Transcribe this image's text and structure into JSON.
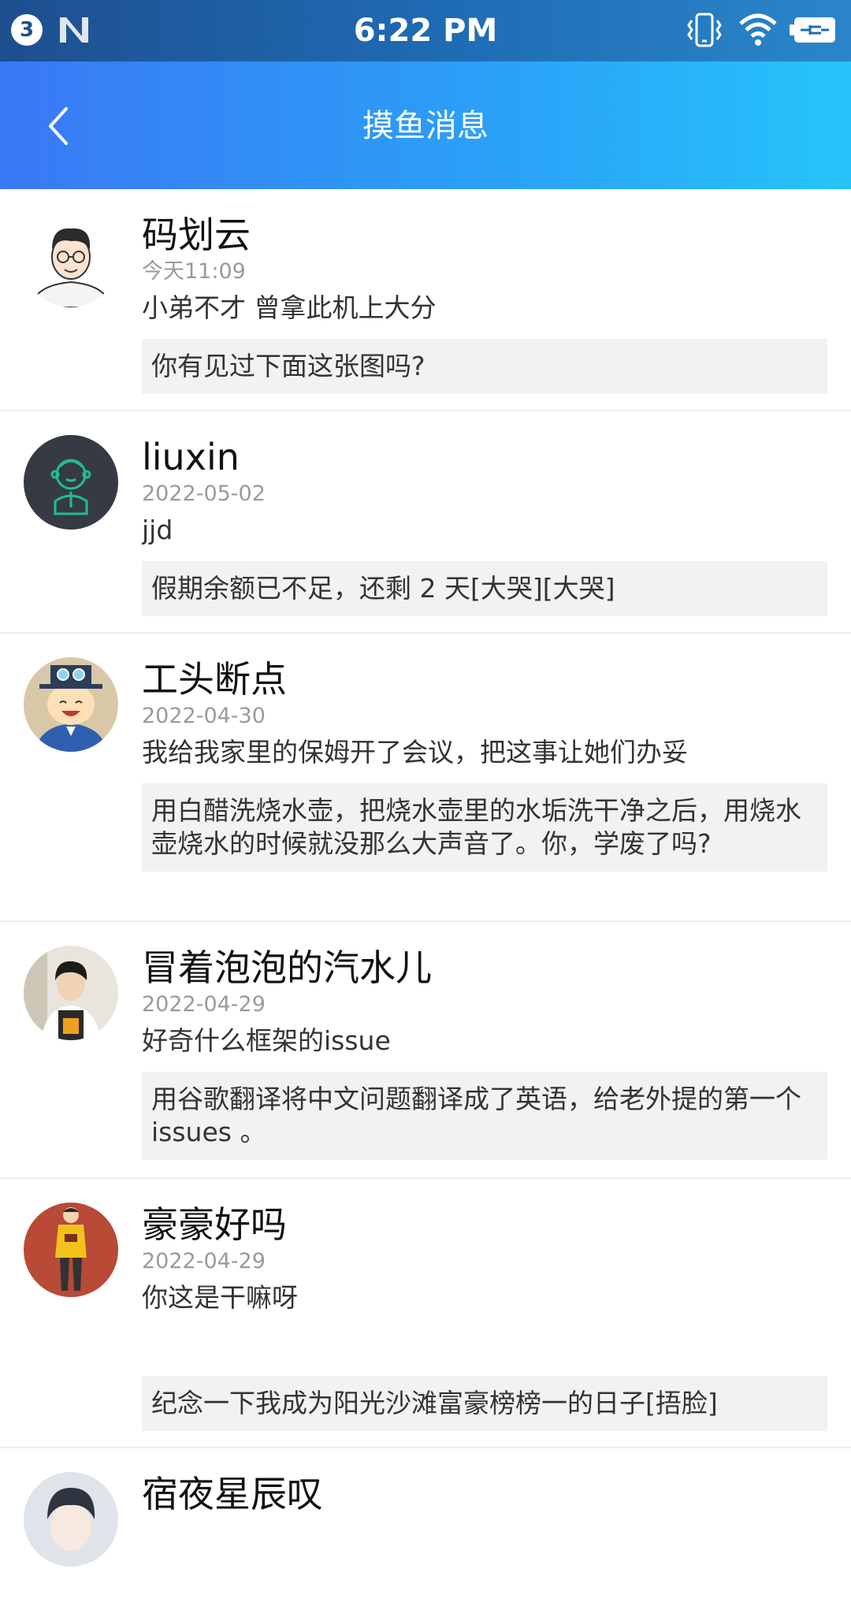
{
  "status_bar": {
    "notification_count": "3",
    "time": "6:22 PM",
    "icons": [
      "notification-badge-icon",
      "n-app-icon",
      "vibrate-icon",
      "wifi-icon",
      "battery-charging-icon"
    ]
  },
  "header": {
    "title": "摸鱼消息",
    "back_icon": "chevron-left-icon"
  },
  "messages": [
    {
      "name": "码划云",
      "date": "今天11:09",
      "text": "小弟不才 曾拿此机上大分",
      "quote": "你有见过下面这张图吗?",
      "avatar": "cartoon-glasses-man"
    },
    {
      "name": "liuxin",
      "date": "2022-05-02",
      "text": "jjd",
      "quote": "假期余额已不足，还剩 2 天[大哭][大哭]",
      "avatar": "default-boy-outline"
    },
    {
      "name": "工头断点",
      "date": "2022-04-30",
      "text": "我给我家里的保姆开了会议，把这事让她们办妥",
      "quote": "用白醋洗烧水壶，把烧水壶里的水垢洗干净之后，用烧水壶烧水的时候就没那么大声音了。你，学废了吗?",
      "avatar": "anime-top-hat-boy"
    },
    {
      "name": "冒着泡泡的汽水儿",
      "date": "2022-04-29",
      "text": "好奇什么框架的issue",
      "quote": "用谷歌翻译将中文问题翻译成了英语，给老外提的第一个 issues 。",
      "avatar": "photo-person"
    },
    {
      "name": "豪豪好吗",
      "date": "2022-04-29",
      "text": "你这是干嘛呀",
      "quote": "纪念一下我成为阳光沙滩富豪榜榜一的日子[捂脸]",
      "avatar": "red-yellow-figure"
    },
    {
      "name": "宿夜星辰叹",
      "date": "",
      "text": "",
      "quote": "",
      "avatar": "anime-character"
    }
  ],
  "colors": {
    "status_bar": "#1e4f8f",
    "app_bar_start": "#3a78f5",
    "app_bar_end": "#26c4fb",
    "quote_bg": "#f2f2f2",
    "date_text": "#9a9a9a"
  }
}
